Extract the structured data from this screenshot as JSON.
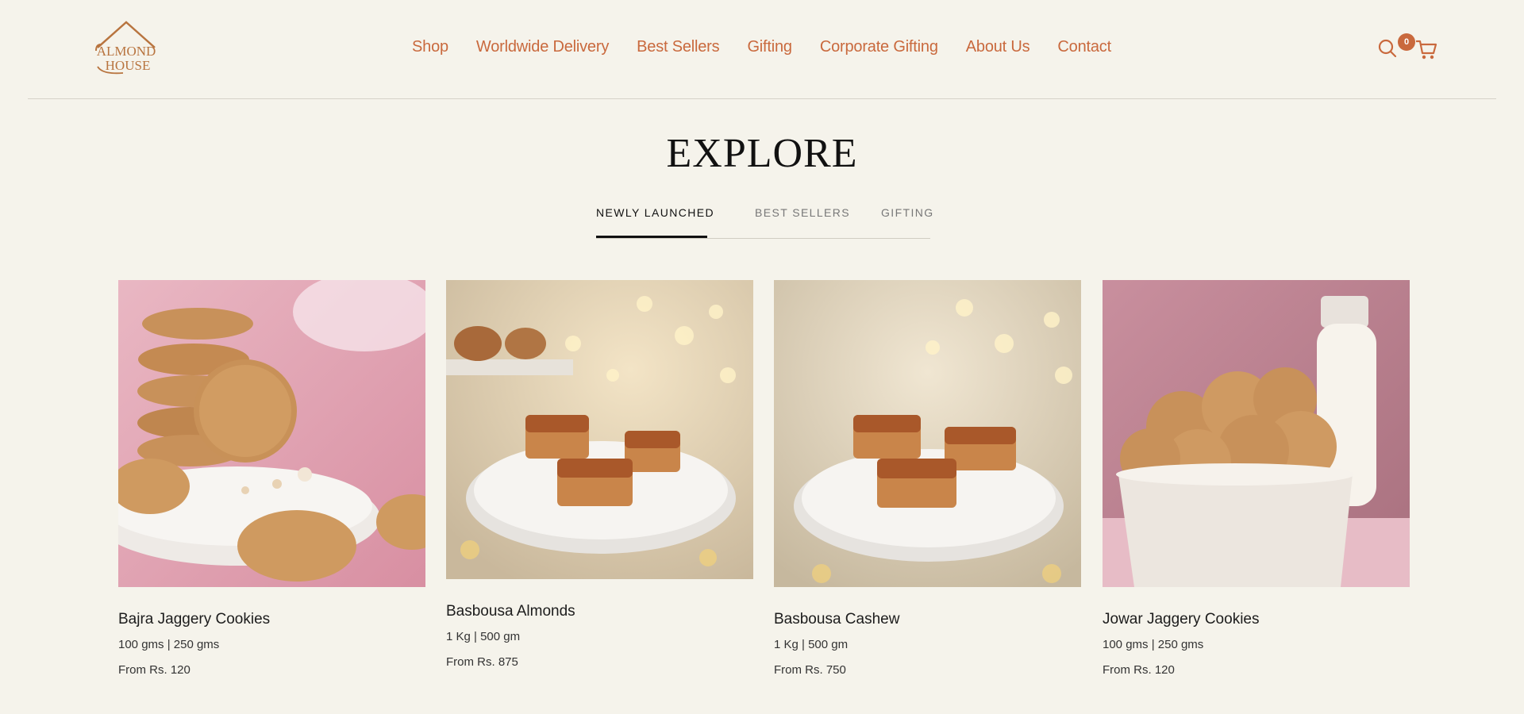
{
  "brand": {
    "logo_line1": "ALMOND",
    "logo_line2": "HOUSE"
  },
  "nav": {
    "items": [
      "Shop",
      "Worldwide Delivery",
      "Best Sellers",
      "Gifting",
      "Corporate Gifting",
      "About Us",
      "Contact"
    ]
  },
  "header_icons": {
    "search": "search-icon",
    "cart": "cart-icon",
    "cart_count": "0"
  },
  "colors": {
    "accent": "#c9693d",
    "background": "#f5f3eb"
  },
  "explore": {
    "title": "EXPLORE",
    "tabs": [
      "NEWLY LAUNCHED",
      "BEST SELLERS",
      "GIFTING"
    ],
    "active_tab": "NEWLY LAUNCHED"
  },
  "products": [
    {
      "name": "Bajra Jaggery Cookies",
      "sizes": "100 gms | 250 gms",
      "price": "From Rs. 120"
    },
    {
      "name": "Basbousa Almonds",
      "sizes": "1 Kg | 500 gm",
      "price": "From Rs. 875"
    },
    {
      "name": "Basbousa Cashew",
      "sizes": "1 Kg | 500 gm",
      "price": "From Rs. 750"
    },
    {
      "name": "Jowar Jaggery Cookies",
      "sizes": "100 gms | 250 gms",
      "price": "From Rs. 120"
    }
  ]
}
